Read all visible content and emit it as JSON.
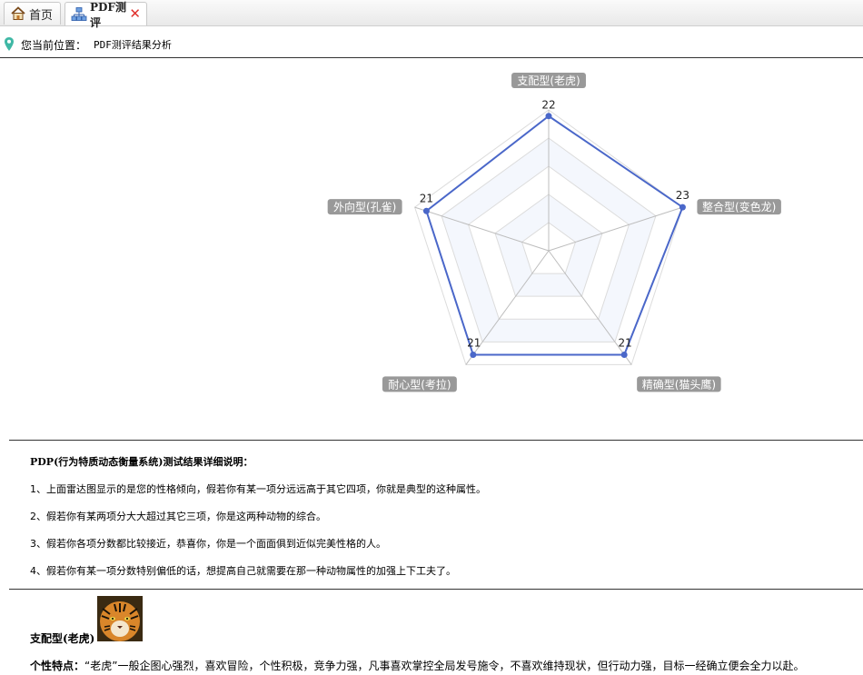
{
  "tabs": [
    {
      "label": "首页",
      "icon": "home-icon"
    },
    {
      "label": "PDF测评",
      "icon": "org-chart-icon",
      "close": "✕"
    }
  ],
  "location": {
    "label": "您当前位置：",
    "value": "PDF测评结果分析"
  },
  "chart_data": {
    "type": "radar",
    "indicators": [
      "支配型(老虎)",
      "整合型(变色龙)",
      "精确型(猫头鹰)",
      "耐心型(考拉)",
      "外向型(孔雀)"
    ],
    "values": [
      22,
      23,
      21,
      21,
      21
    ],
    "max": 23,
    "series_color": "#4a67c9"
  },
  "description": {
    "title": "PDP(行为特质动态衡量系统)测试结果详细说明：",
    "items": [
      "1、上面雷达图显示的是您的性格倾向，假若你有某一项分远远高于其它四项，你就是典型的这种属性。",
      "2、假若你有某两项分大大超过其它三项，你是这两种动物的综合。",
      "3、假若你各项分数都比较接近，恭喜你，你是一个面面俱到近似完美性格的人。",
      "4、假若你有某一项分数特别偏低的话，想提高自己就需要在那一种动物属性的加强上下工夫了。"
    ]
  },
  "result": {
    "name": "支配型(老虎)",
    "trait_label": "个性特点：",
    "trait_text": "“老虎”一般企图心强烈，喜欢冒险，个性积极，竞争力强，凡事喜欢掌控全局发号施令，不喜欢维持现状，但行动力强，目标一经确立便会全力以赴。"
  }
}
